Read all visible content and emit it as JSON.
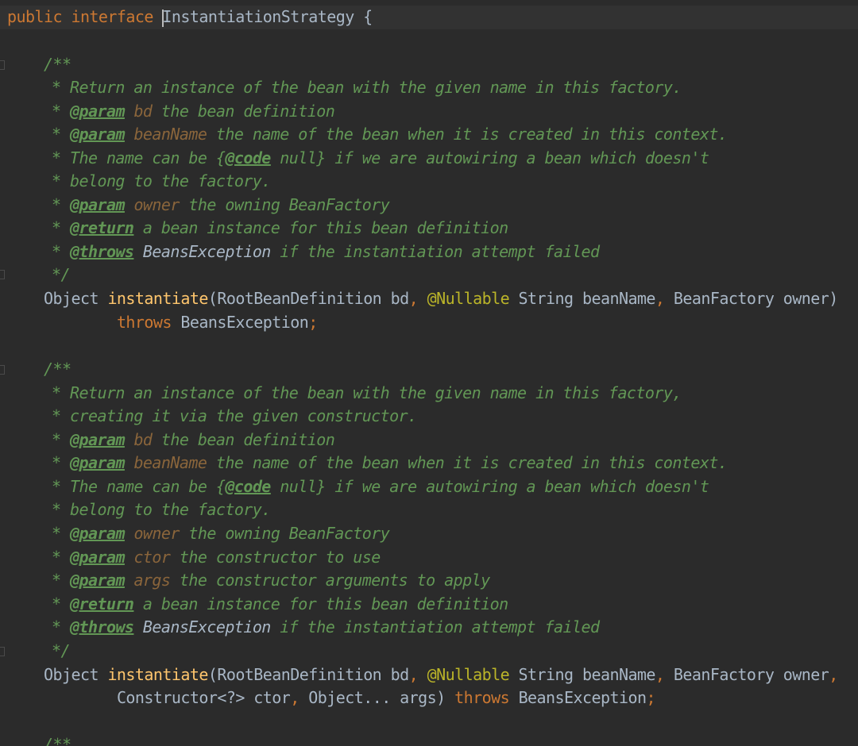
{
  "line1": {
    "kw_public": "public",
    "kw_interface": "interface",
    "name": "InstantiationStrategy",
    "brace": " {"
  },
  "doc1": {
    "open": "/**",
    "l1": "* Return an instance of the bean with the given name in this factory.",
    "l2_star": "* ",
    "l2_tag": "@param",
    "l2_param": "bd",
    "l2_text": " the bean definition",
    "l3_star": "* ",
    "l3_tag": "@param",
    "l3_param": "beanName",
    "l3_text": " the name of the bean when it is created in this context.",
    "l4_a": "* The name can be {",
    "l4_tag": "@code",
    "l4_b": " null} if we are autowiring a bean which doesn't",
    "l5": "* belong to the factory.",
    "l6_star": "* ",
    "l6_tag": "@param",
    "l6_param": "owner",
    "l6_text": " the owning BeanFactory",
    "l7_star": "* ",
    "l7_tag": "@return",
    "l7_text": " a bean instance for this bean definition",
    "l8_star": "* ",
    "l8_tag": "@throws",
    "l8_ref": "BeansException",
    "l8_text": " if the instantiation attempt failed",
    "close": "*/"
  },
  "method1": {
    "ret": "Object ",
    "name": "instantiate",
    "p1": "(RootBeanDefinition bd",
    "comma1": ", ",
    "anno": "@Nullable",
    "p2": " String beanName",
    "comma2": ", ",
    "p3": "BeanFactory owner)",
    "indent": "        ",
    "throws": "throws",
    "exc": " BeansException",
    "semi": ";"
  },
  "doc2": {
    "open": "/**",
    "l1": "* Return an instance of the bean with the given name in this factory,",
    "l2": "* creating it via the given constructor.",
    "l3_star": "* ",
    "l3_tag": "@param",
    "l3_param": "bd",
    "l3_text": " the bean definition",
    "l4_star": "* ",
    "l4_tag": "@param",
    "l4_param": "beanName",
    "l4_text": " the name of the bean when it is created in this context.",
    "l5_a": "* The name can be {",
    "l5_tag": "@code",
    "l5_b": " null} if we are autowiring a bean which doesn't",
    "l6": "* belong to the factory.",
    "l7_star": "* ",
    "l7_tag": "@param",
    "l7_param": "owner",
    "l7_text": " the owning BeanFactory",
    "l8_star": "* ",
    "l8_tag": "@param",
    "l8_param": "ctor",
    "l8_text": " the constructor to use",
    "l9_star": "* ",
    "l9_tag": "@param",
    "l9_param": "args",
    "l9_text": " the constructor arguments to apply",
    "l10_star": "* ",
    "l10_tag": "@return",
    "l10_text": " a bean instance for this bean definition",
    "l11_star": "* ",
    "l11_tag": "@throws",
    "l11_ref": "BeansException",
    "l11_text": " if the instantiation attempt failed",
    "close": "*/"
  },
  "method2": {
    "ret": "Object ",
    "name": "instantiate",
    "p1": "(RootBeanDefinition bd",
    "comma1": ", ",
    "anno": "@Nullable",
    "p2": " String beanName",
    "comma2": ", ",
    "p3": "BeanFactory owner",
    "comma3": ",",
    "indent": "        ",
    "p4": "Constructor<?> ctor",
    "comma4": ", ",
    "p5": "Object... args) ",
    "throws": "throws",
    "exc": " BeansException",
    "semi": ";"
  },
  "doc3": {
    "open": "/**"
  }
}
